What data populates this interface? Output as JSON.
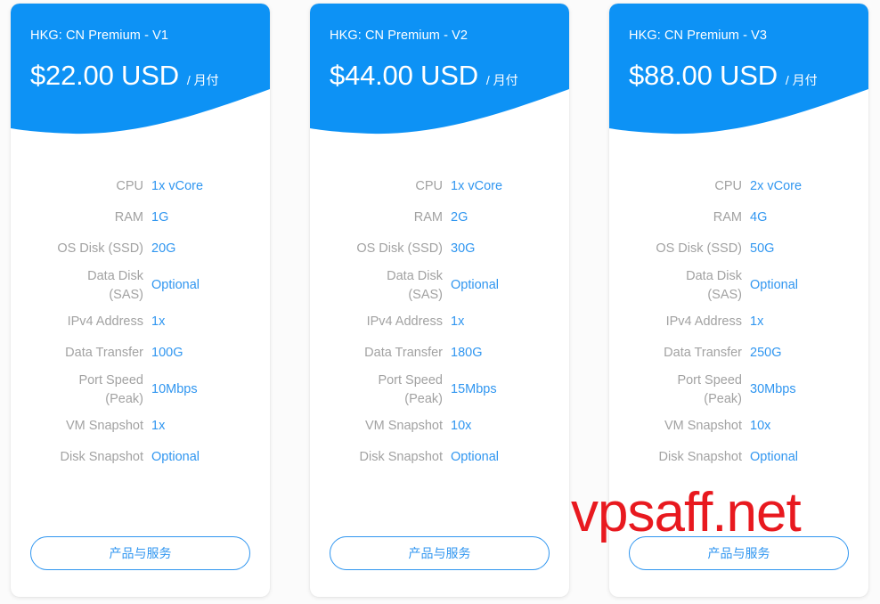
{
  "theme": {
    "header_blue": "#0d92f5",
    "value_blue": "#3096f0",
    "label_gray": "#a2a2a2",
    "page_background": "#fbfbfb",
    "watermark_red": "#e8191f"
  },
  "watermark": {
    "text": "vpsaff.net"
  },
  "feature_labels": {
    "cpu": "CPU",
    "ram": "RAM",
    "os_disk": "OS Disk (SSD)",
    "data_disk_line1": "Data Disk",
    "data_disk_line2": "(SAS)",
    "ipv4": "IPv4 Address",
    "data_transfer": "Data Transfer",
    "port_speed_line1": "Port Speed",
    "port_speed_line2": "(Peak)",
    "vm_snapshot": "VM Snapshot",
    "disk_snapshot": "Disk Snapshot"
  },
  "cards": [
    {
      "title": "HKG: CN Premium - V1",
      "price": "$22.00 USD",
      "period": "/ 月付",
      "cpu": "1x vCore",
      "ram": "1G",
      "os_disk": "20G",
      "data_disk": "Optional",
      "ipv4": "1x",
      "data_transfer": "100G",
      "port_speed": "10Mbps",
      "vm_snapshot": "1x",
      "disk_snapshot": "Optional",
      "cta_label": "产品与服务"
    },
    {
      "title": "HKG: CN Premium - V2",
      "price": "$44.00 USD",
      "period": "/ 月付",
      "cpu": "1x vCore",
      "ram": "2G",
      "os_disk": "30G",
      "data_disk": "Optional",
      "ipv4": "1x",
      "data_transfer": "180G",
      "port_speed": "15Mbps",
      "vm_snapshot": "10x",
      "disk_snapshot": "Optional",
      "cta_label": "产品与服务"
    },
    {
      "title": "HKG: CN Premium - V3",
      "price": "$88.00 USD",
      "period": "/ 月付",
      "cpu": "2x vCore",
      "ram": "4G",
      "os_disk": "50G",
      "data_disk": "Optional",
      "ipv4": "1x",
      "data_transfer": "250G",
      "port_speed": "30Mbps",
      "vm_snapshot": "10x",
      "disk_snapshot": "Optional",
      "cta_label": "产品与服务"
    }
  ]
}
